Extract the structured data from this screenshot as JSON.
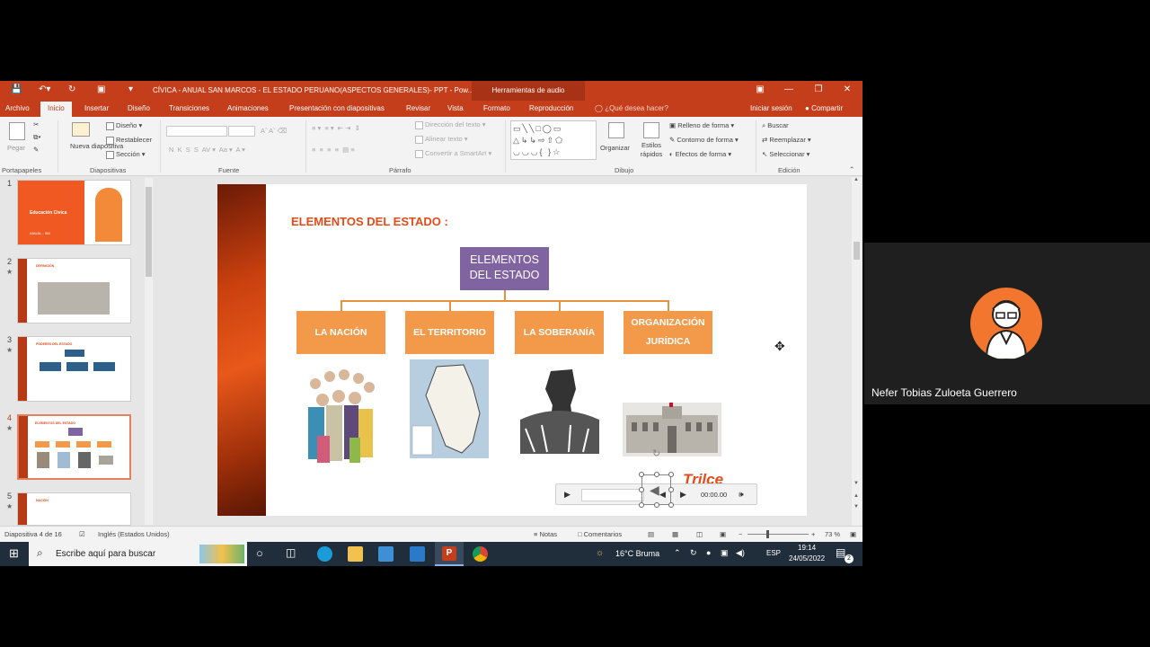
{
  "window": {
    "title": "CÍVICA - ANUAL SAN MARCOS - EL ESTADO PERUANO(ASPECTOS GENERALES)- PPT - Pow...",
    "contextual_tab": "Herramientas de audio"
  },
  "tabs": [
    "Archivo",
    "Inicio",
    "Insertar",
    "Diseño",
    "Transiciones",
    "Animaciones",
    "Presentación con diapositivas",
    "Revisar",
    "Vista",
    "Formato",
    "Reproducción"
  ],
  "tell_me": "¿Qué desea hacer?",
  "signin": "Iniciar sesión",
  "share": "Compartir",
  "ribbon": {
    "paste": "Pegar",
    "new_slide": "Nueva diapositiva",
    "design": "Diseño",
    "reset": "Restablecer",
    "section": "Sección",
    "text_direction": "Dirección del texto",
    "align_text": "Alinear texto",
    "convert_smartart": "Convertir a SmartArt",
    "organize": "Organizar",
    "quick_styles": "Estilos rápidos",
    "shape_fill": "Relleno de forma",
    "shape_outline": "Contorno de forma",
    "shape_effects": "Efectos de forma",
    "find": "Buscar",
    "replace": "Reemplazar",
    "select": "Seleccionar",
    "groups": {
      "clipboard": "Portapapeles",
      "slides": "Diapositivas",
      "font": "Fuente",
      "paragraph": "Párrafo",
      "drawing": "Dibujo",
      "editing": "Edición"
    }
  },
  "thumbnails": [
    {
      "num": "1",
      "title": "Educación Cívica",
      "subtitle": "ANUAL - SM"
    },
    {
      "num": "2",
      "title": "DEFINICIÓN"
    },
    {
      "num": "3",
      "title": "PODERES DEL ESTADO"
    },
    {
      "num": "4",
      "title": "ELEMENTOS DEL ESTADO"
    },
    {
      "num": "5",
      "title": "NACIÓN"
    }
  ],
  "slide": {
    "heading": "ELEMENTOS DEL ESTADO :",
    "top_box": "ELEMENTOS DEL ESTADO",
    "boxes": [
      "LA NACIÓN",
      "EL TERRITORIO",
      "LA SOBERANÍA",
      "ORGANIZACIÓN JURÍDICA"
    ],
    "logo": "Trilce",
    "media_time": "00:00.00"
  },
  "status": {
    "slide_info": "Diapositiva 4 de 16",
    "language": "Inglés (Estados Unidos)",
    "notes": "Notas",
    "comments": "Comentarios",
    "zoom": "73 %"
  },
  "taskbar": {
    "search_placeholder": "Escribe aquí para buscar",
    "weather": "16°C  Bruma",
    "lang": "ESP",
    "time": "19:14",
    "date": "24/05/2022",
    "notifications": "2"
  },
  "participant": {
    "name": "Nefer Tobias Zuloeta Guerrero"
  },
  "colors": {
    "ppt_accent": "#c43e1c",
    "org_top": "#8064a2",
    "org_box": "#f39a4a",
    "heading": "#e34b1a"
  }
}
